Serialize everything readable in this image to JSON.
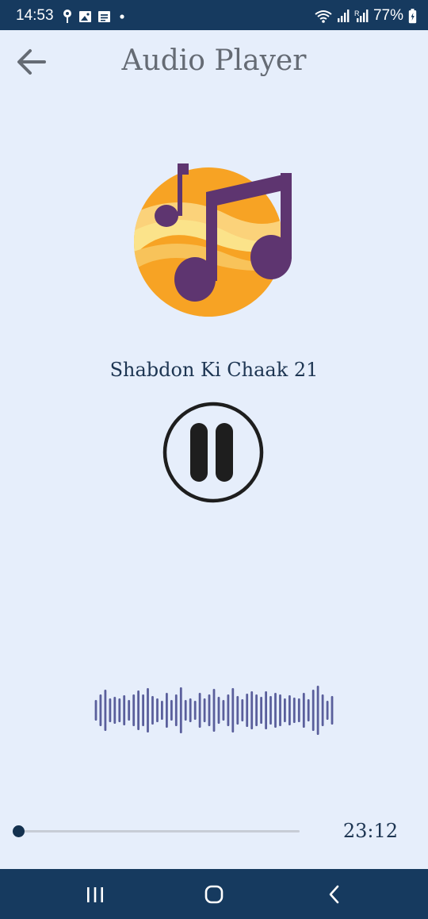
{
  "status_bar": {
    "time": "14:53",
    "battery_percent": "77%",
    "left_icons": [
      "location-pin-icon",
      "image-icon",
      "notes-icon",
      "dot-icon"
    ],
    "right_icons": [
      "wifi-icon",
      "signal-icon",
      "signal-r-icon",
      "battery-icon"
    ]
  },
  "app_bar": {
    "title": "Audio Player",
    "back_icon": "arrow-left-icon"
  },
  "player": {
    "track_title": "Shabdon Ki Chaak 21",
    "state": "playing",
    "duration": "23:12",
    "progress": 0.0
  },
  "colors": {
    "background": "#e6eefb",
    "status_bar": "#163a5f",
    "title_text": "#656b74",
    "track_text": "#1d3552",
    "waveform": "#5a5f9c",
    "album_orange": "#f7a324",
    "album_purple": "#5e3570"
  },
  "nav_bar": {
    "icons": [
      "recents-icon",
      "home-icon",
      "back-icon"
    ]
  }
}
